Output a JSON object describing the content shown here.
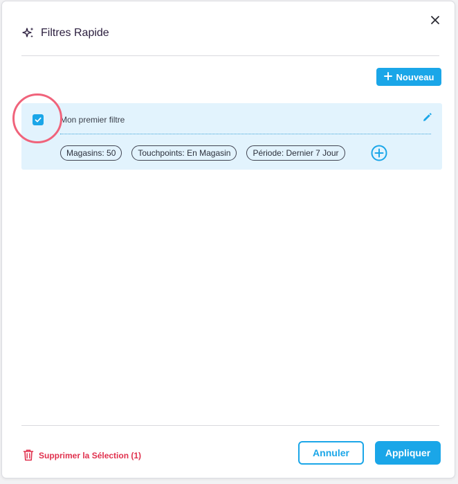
{
  "header": {
    "title": "Filtres Rapide",
    "title_icon": "sparkles-icon",
    "close_icon": "close-icon"
  },
  "toolbar": {
    "new_label": "Nouveau",
    "new_icon": "plus-icon"
  },
  "filters": [
    {
      "name": "Mon premier filtre",
      "checked": true,
      "chips": [
        "Magasins: 50",
        "Touchpoints: En Magasin",
        "Période: Dernier 7 Jour"
      ]
    }
  ],
  "footer": {
    "delete_label": "Supprimer la Sélection (1)",
    "delete_icon": "trash-icon",
    "cancel_label": "Annuler",
    "apply_label": "Appliquer"
  },
  "colors": {
    "accent": "#1aa6e8",
    "danger": "#e0304d",
    "card_bg": "#e2f3fd",
    "highlight": "#f0637b"
  }
}
